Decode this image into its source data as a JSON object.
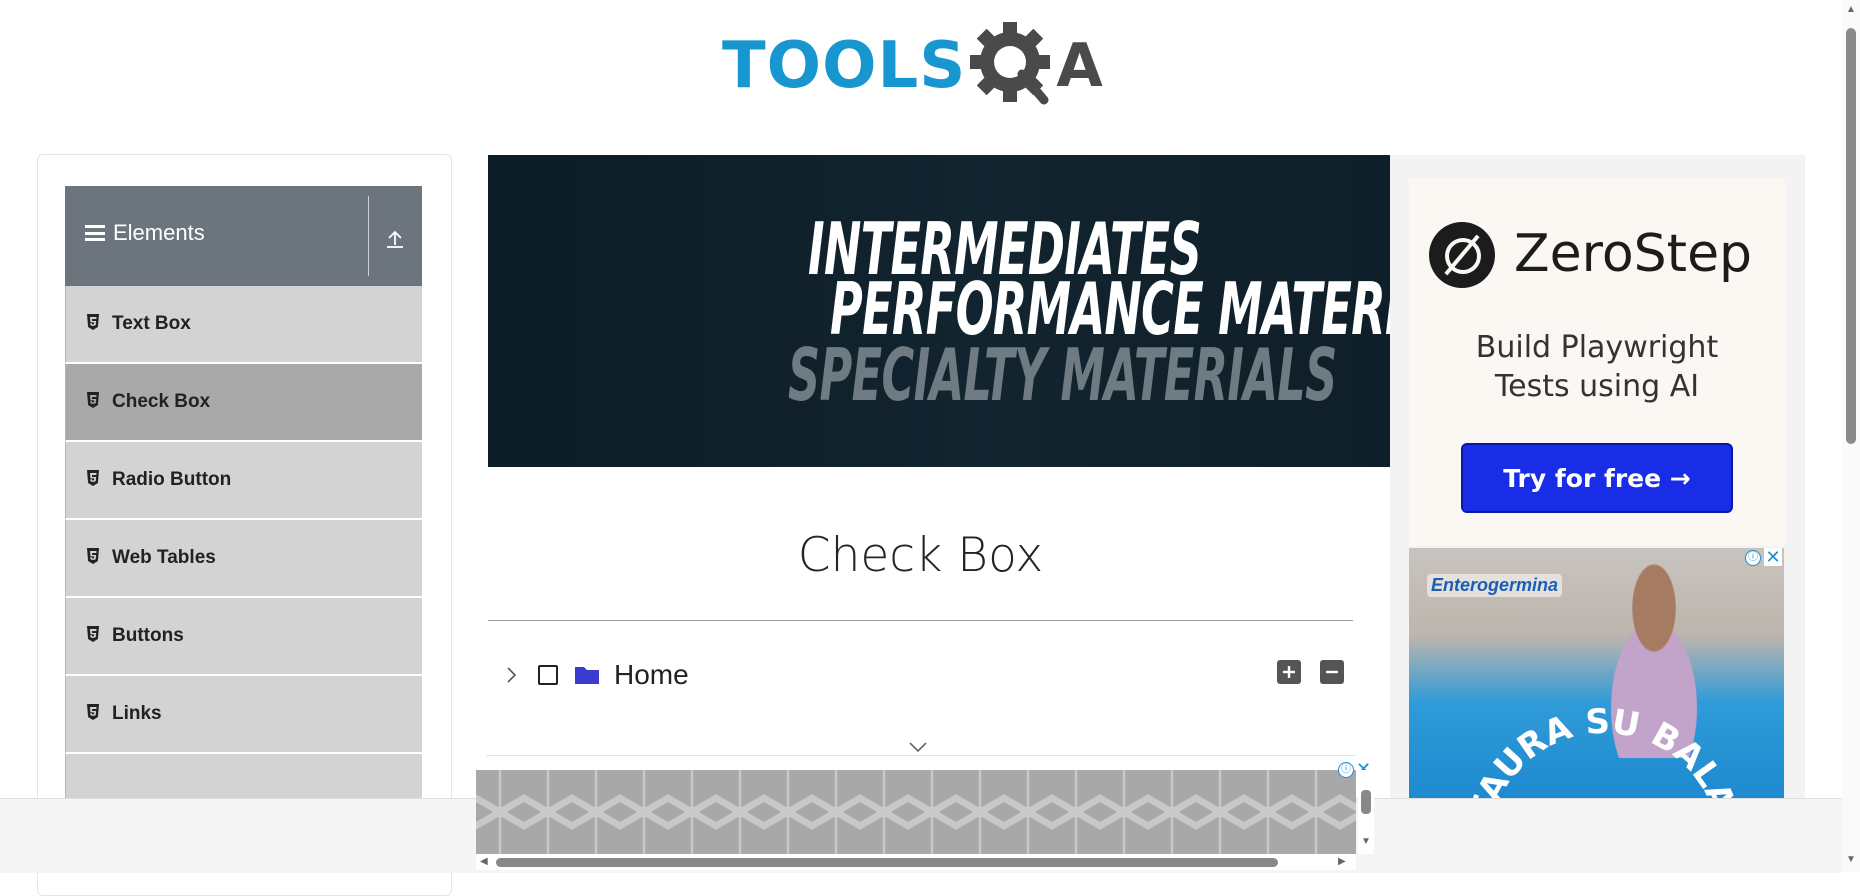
{
  "header": {
    "logo_tools": "TOOLS",
    "logo_a": "A",
    "colors": {
      "tools_blue": "#1796cf",
      "qa_gray": "#4a4a4a"
    }
  },
  "sidebar": {
    "group_title": "Elements",
    "group_icon": "hamburger-icon",
    "collapse_icon": "collapse-up-icon",
    "items": [
      {
        "label": "Text Box",
        "icon": "html5-icon"
      },
      {
        "label": "Check Box",
        "icon": "html5-icon",
        "active": true
      },
      {
        "label": "Radio Button",
        "icon": "html5-icon"
      },
      {
        "label": "Web Tables",
        "icon": "html5-icon"
      },
      {
        "label": "Buttons",
        "icon": "html5-icon"
      },
      {
        "label": "Links",
        "icon": "html5-icon"
      }
    ]
  },
  "banner": {
    "line1": "INTERMEDIATES",
    "line2": "PERFORMANCE MATERIALS",
    "line3": "SPECIALTY MATERIALS"
  },
  "main": {
    "title": "Check Box",
    "tree": {
      "root_label": "Home",
      "expand_icon": "chevron-right-icon",
      "folder_icon": "folder-icon",
      "expand_all_icon": "plus-square-icon",
      "collapse_all_icon": "minus-square-icon"
    }
  },
  "right_ad": {
    "brand": "ZeroStep",
    "tagline_1": "Build Playwright",
    "tagline_2": "Tests using AI",
    "cta": "Try for free →",
    "cta_color": "#1a2de6",
    "second_ad_brand": "Enterogermina",
    "second_ad_text": "STAURA SU BALANCE",
    "info_icon": "ⓘ",
    "close_icon": "✕"
  },
  "bottom_ad": {
    "info_icon": "ⓘ",
    "close_icon": "✕"
  }
}
